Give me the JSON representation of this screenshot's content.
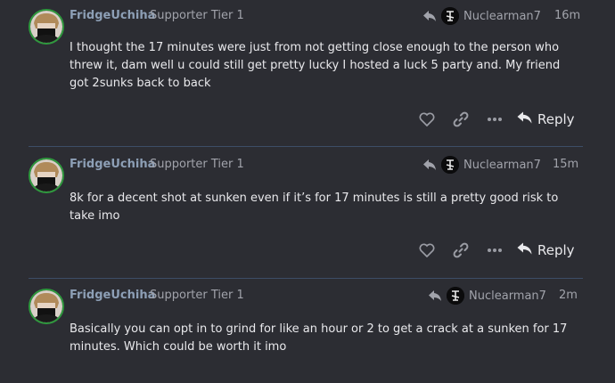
{
  "posts": [
    {
      "username": "FridgeUchiha",
      "user_title": "Supporter Tier 1",
      "reply_to_user": "Nuclearman7",
      "time": "16m",
      "body": "I thought the 17 minutes were just from not getting close enough to the person who threw it, dam well u could still get pretty lucky I hosted a luck 5 party and. My friend got 2sunks back to back",
      "reply_label": "Reply"
    },
    {
      "username": "FridgeUchiha",
      "user_title": "Supporter Tier 1",
      "reply_to_user": "Nuclearman7",
      "time": "15m",
      "body": "8k for a decent shot at sunken even if it’s for 17 minutes is still a pretty good risk to take imo",
      "reply_label": "Reply"
    },
    {
      "username": "FridgeUchiha",
      "user_title": "Supporter Tier 1",
      "reply_to_user": "Nuclearman7",
      "time": "2m",
      "body": "Basically you can opt in to grind for like an hour or 2 to get a crack at a sunken for 17 minutes. Which could be worth it imo"
    }
  ],
  "icons": {
    "like": "heart-icon",
    "link": "link-icon",
    "more": "ellipsis-icon",
    "reply": "reply-arrow-icon",
    "reply_to": "share-arrow-icon"
  },
  "colors": {
    "background": "#2c2d33",
    "username": "#8d9fb6",
    "avatar_border": "#2f9a3e",
    "divider": "#3d4d66"
  }
}
